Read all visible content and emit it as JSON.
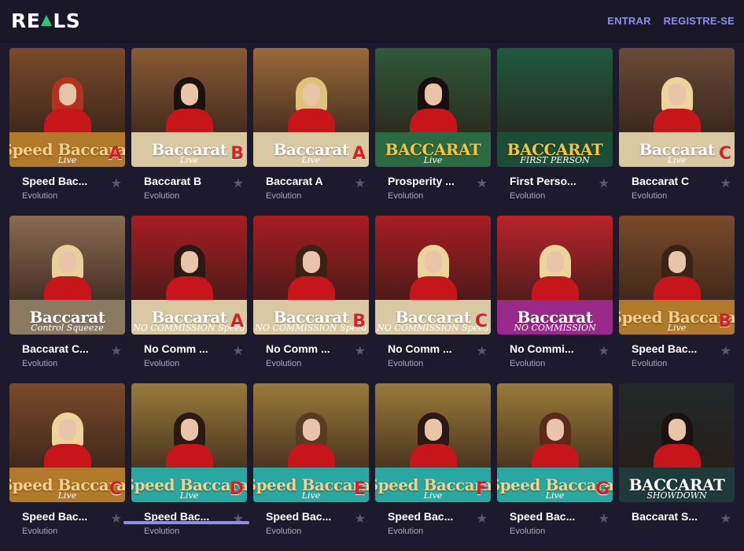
{
  "header": {
    "logo_left": "RE",
    "logo_right": "LS",
    "login": "ENTRAR",
    "register": "REGISTRE-SE"
  },
  "games": [
    {
      "name": "Speed Bac...",
      "provider": "Evolution",
      "banner": "Speed Baccarat",
      "sub": "Live",
      "letter": "A",
      "bg": "#7a4a2a",
      "banner_bg": "#b07a2a",
      "banner_color": "#f5d08a",
      "hair": "#b2321f"
    },
    {
      "name": "Baccarat B",
      "provider": "Evolution",
      "banner": "Baccarat",
      "sub": "Live",
      "letter": "B",
      "bg": "#8a5a35",
      "banner_bg": "#d9c9a3",
      "banner_color": "#fff",
      "hair": "#1a1210"
    },
    {
      "name": "Baccarat A",
      "provider": "Evolution",
      "banner": "Baccarat",
      "sub": "Live",
      "letter": "A",
      "bg": "#9a6a3a",
      "banner_bg": "#d9c9a3",
      "banner_color": "#fff",
      "hair": "#e0c27a"
    },
    {
      "name": "Prosperity ...",
      "provider": "Evolution",
      "banner": "BACCARAT",
      "sub": "Live",
      "letter": "",
      "bg": "#2f5a3a",
      "banner_bg": "#2c6a43",
      "banner_color": "#f5c542",
      "hair": "#16110f"
    },
    {
      "name": "First Perso...",
      "provider": "Evolution",
      "banner": "BACCARAT",
      "sub": "FIRST PERSON",
      "letter": "",
      "bg": "#1f5a40",
      "banner_bg": "#1c4d36",
      "banner_color": "#f5c542",
      "hair": ""
    },
    {
      "name": "Baccarat C",
      "provider": "Evolution",
      "banner": "Baccarat",
      "sub": "Live",
      "letter": "C",
      "bg": "#6a4a36",
      "banner_bg": "#d9c9a3",
      "banner_color": "#fff",
      "hair": "#ecd49a"
    },
    {
      "name": "Baccarat C...",
      "provider": "Evolution",
      "banner": "Baccarat",
      "sub": "Control Squeeze",
      "letter": "",
      "bg": "#8a6a52",
      "banner_bg": "#8a7a62",
      "banner_color": "#fff",
      "hair": "#e8d09a"
    },
    {
      "name": "No Comm ...",
      "provider": "Evolution",
      "banner": "Baccarat",
      "sub": "NO COMMISSION Speed",
      "letter": "A",
      "bg": "#a81d22",
      "banner_bg": "#d9c9a3",
      "banner_color": "#fff",
      "hair": "#2a1a12"
    },
    {
      "name": "No Comm ...",
      "provider": "Evolution",
      "banner": "Baccarat",
      "sub": "NO COMMISSION Speed",
      "letter": "B",
      "bg": "#a81d22",
      "banner_bg": "#d9c9a3",
      "banner_color": "#fff",
      "hair": "#3a2216"
    },
    {
      "name": "No Comm ...",
      "provider": "Evolution",
      "banner": "Baccarat",
      "sub": "NO COMMISSION Speed",
      "letter": "C",
      "bg": "#a81d22",
      "banner_bg": "#d9c9a3",
      "banner_color": "#fff",
      "hair": "#ecd49a"
    },
    {
      "name": "No Commi...",
      "provider": "Evolution",
      "banner": "Baccarat",
      "sub": "NO COMMISSION",
      "letter": "",
      "bg": "#b8232a",
      "banner_bg": "#9a2a8a",
      "banner_color": "#fff",
      "hair": "#ecd49a"
    },
    {
      "name": "Speed Bac...",
      "provider": "Evolution",
      "banner": "Speed Baccarat",
      "sub": "Live",
      "letter": "B",
      "bg": "#7a4a2a",
      "banner_bg": "#b07a2a",
      "banner_color": "#f5d08a",
      "hair": "#3a2216"
    },
    {
      "name": "Speed Bac...",
      "provider": "Evolution",
      "banner": "Speed Baccarat",
      "sub": "Live",
      "letter": "C",
      "bg": "#7a4a2a",
      "banner_bg": "#b07a2a",
      "banner_color": "#f5d08a",
      "hair": "#ecd49a"
    },
    {
      "name": "Speed Bac...",
      "provider": "Evolution",
      "banner": "Speed Baccarat",
      "sub": "Live",
      "letter": "D",
      "bg": "#9a7a3a",
      "banner_bg": "#2aa7a0",
      "banner_color": "#f5d08a",
      "hair": "#2a1a12"
    },
    {
      "name": "Speed Bac...",
      "provider": "Evolution",
      "banner": "Speed Baccarat",
      "sub": "Live",
      "letter": "E",
      "bg": "#9a7a3a",
      "banner_bg": "#2aa7a0",
      "banner_color": "#f5d08a",
      "hair": "#5a3a22"
    },
    {
      "name": "Speed Bac...",
      "provider": "Evolution",
      "banner": "Speed Baccarat",
      "sub": "Live",
      "letter": "F",
      "bg": "#9a7a3a",
      "banner_bg": "#2aa7a0",
      "banner_color": "#f5d08a",
      "hair": "#2a1a12"
    },
    {
      "name": "Speed Bac...",
      "provider": "Evolution",
      "banner": "Speed Baccarat",
      "sub": "Live",
      "letter": "G",
      "bg": "#9a7a3a",
      "banner_bg": "#2aa7a0",
      "banner_color": "#f5d08a",
      "hair": "#5a2a1a"
    },
    {
      "name": "Baccarat S...",
      "provider": "",
      "banner": "BACCARAT",
      "sub": "SHOWDOWN",
      "letter": "",
      "bg": "#1f2a2a",
      "banner_bg": "#1f3a3a",
      "banner_color": "#fff",
      "hair": "#1a1210"
    }
  ]
}
